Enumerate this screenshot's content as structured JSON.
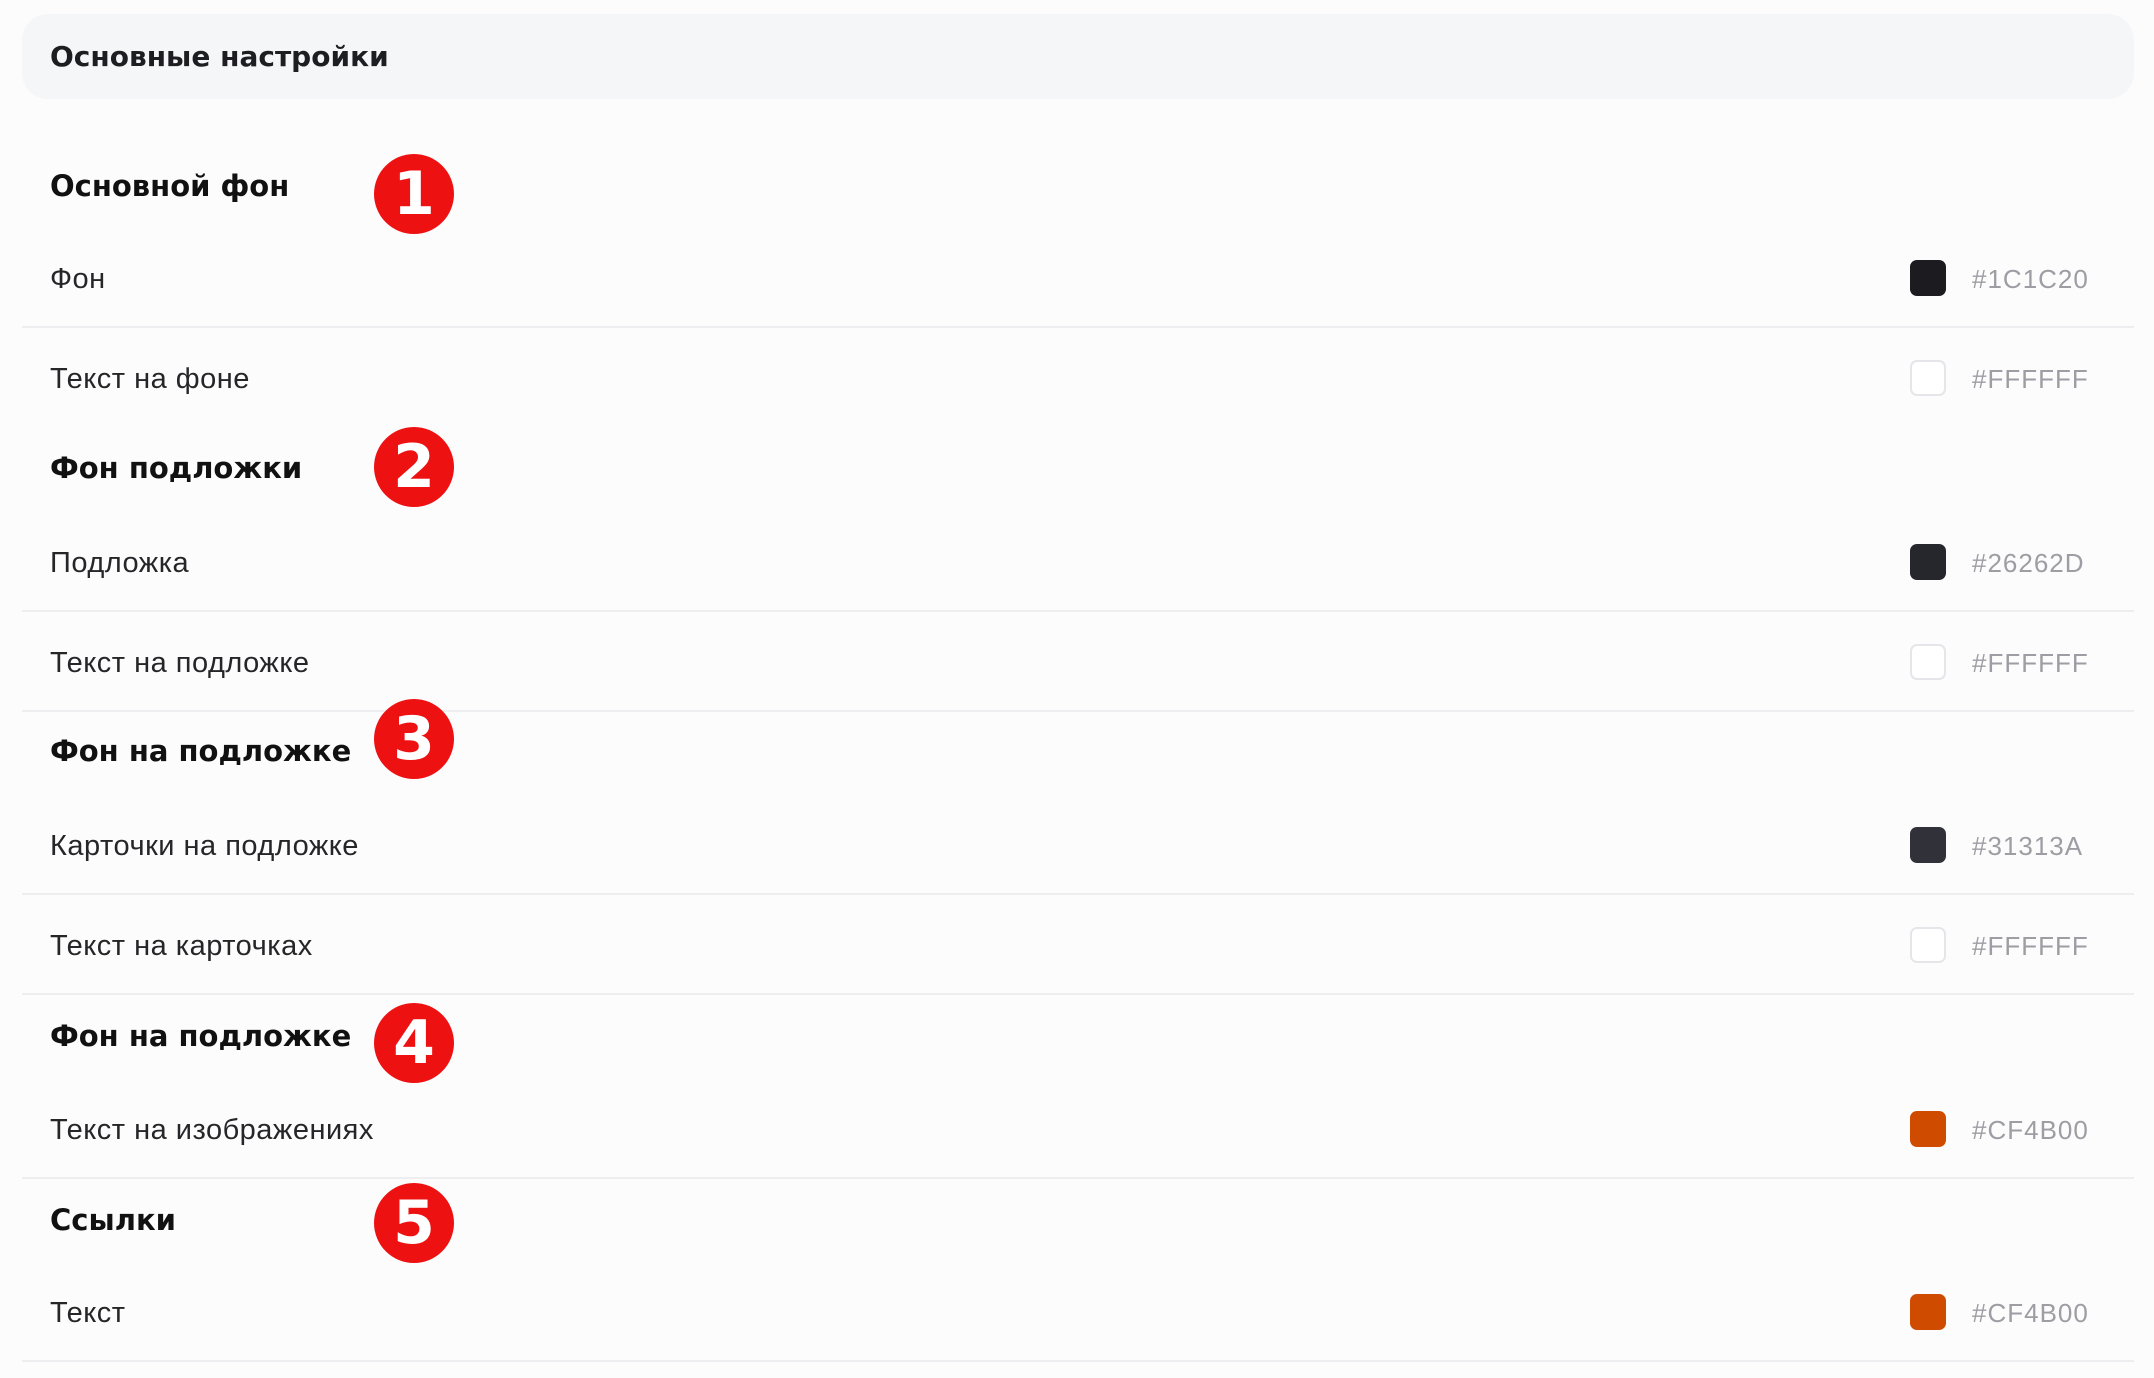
{
  "header": {
    "title": "Основные настройки"
  },
  "sections": [
    {
      "title": "Основной фон",
      "badge": "1",
      "rows": [
        {
          "label": "Фон",
          "hex": "#1C1C20",
          "color": "#1C1C20"
        },
        {
          "label": "Текст на фоне",
          "hex": "#FFFFFF",
          "color": "#FFFFFF"
        }
      ]
    },
    {
      "title": "Фон подложки",
      "badge": "2",
      "rows": [
        {
          "label": "Подложка",
          "hex": "#26262D",
          "color": "#26262D"
        },
        {
          "label": "Текст на подложке",
          "hex": "#FFFFFF",
          "color": "#FFFFFF"
        }
      ]
    },
    {
      "title": "Фон на подложке",
      "badge": "3",
      "rows": [
        {
          "label": "Карточки на подложке",
          "hex": "#31313A",
          "color": "#31313A"
        },
        {
          "label": "Текст на карточках",
          "hex": "#FFFFFF",
          "color": "#FFFFFF"
        }
      ]
    },
    {
      "title": "Фон на подложке",
      "badge": "4",
      "rows": [
        {
          "label": "Текст на изображениях",
          "hex": "#CF4B00",
          "color": "#CF4B00"
        }
      ]
    },
    {
      "title": "Ссылки",
      "badge": "5",
      "rows": [
        {
          "label": "Текст",
          "hex": "#CF4B00",
          "color": "#CF4B00"
        }
      ]
    }
  ]
}
